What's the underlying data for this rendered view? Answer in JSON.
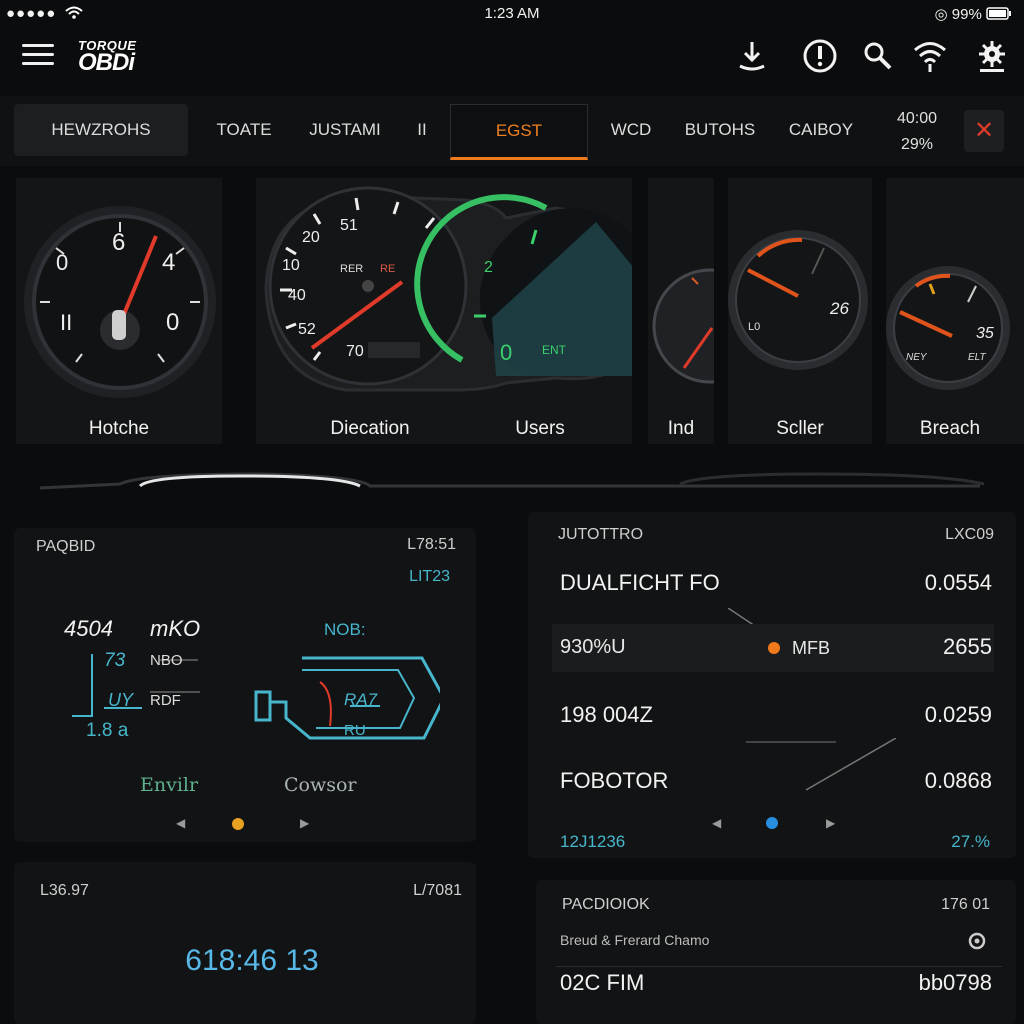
{
  "status_bar": {
    "signal": "●●●●●",
    "time": "1:23 AM",
    "battery": "99%"
  },
  "app": {
    "logo_line1": "TORQUE",
    "logo_line2": "OBDi"
  },
  "icons": [
    "menu-icon",
    "download-icon",
    "alert-icon",
    "search-icon",
    "wifi-icon",
    "settings-icon"
  ],
  "tabs": {
    "items": [
      "HEWZROHS",
      "TOATE",
      "JUSTAMI",
      "II",
      "EGST",
      "WCD",
      "BUTOHS",
      "CAIBOY"
    ],
    "active_index": 4,
    "stat_top": "40:00",
    "stat_bottom": "29%",
    "close": "✕"
  },
  "gauges": {
    "labels": [
      "Hotche",
      "Diecation",
      "Users",
      "Ind",
      "Scller",
      "Breach"
    ],
    "g1_ticks": [
      "6",
      "4",
      "0",
      "0",
      "II"
    ],
    "speedo_ticks": [
      "10",
      "20",
      "40",
      "52",
      "51",
      "70"
    ],
    "speedo_sub": [
      "RER",
      "RE"
    ],
    "green_ticks": [
      "2",
      "0",
      "ENT"
    ],
    "g5_ticks": [
      "26",
      "L0"
    ],
    "g6_ticks": [
      "35",
      "NEY",
      "ELT"
    ]
  },
  "card_left_top": {
    "title": "PAQBID",
    "code": "L78:51",
    "sub": "LIT23",
    "big_value": "4504",
    "big_unit": "mKO",
    "ticks": [
      "73",
      "NBO",
      "UY",
      "RDF",
      "1.8 a"
    ],
    "engine_label": "NOB:",
    "engine_labels": [
      "RA7",
      "RU"
    ],
    "footer_left": "Envilr",
    "footer_right": "Cowsor",
    "accent": "#e8a020"
  },
  "card_right_top": {
    "title": "JUTOTTRO",
    "code": "LXC09",
    "rows": [
      {
        "label": "DUALFICHT FO",
        "value": "0.0554"
      },
      {
        "label": "930%U",
        "mid": "MFB",
        "value": "2655"
      },
      {
        "label": "198 004Z",
        "value": "0.0259"
      },
      {
        "label": "FOBOTOR",
        "value": "0.0868"
      }
    ],
    "footer_left": "12J1236",
    "footer_right": "27.%",
    "accent": "#2a8ee0",
    "mid_dot_color": "#ef7a1c"
  },
  "card_left_bottom": {
    "title": "L36.97",
    "code": "L/7081",
    "value": "618:46 13"
  },
  "card_right_bottom": {
    "title": "PACDIOIOK",
    "code": "176 01",
    "subtitle": "Breud & Frerard Chamo",
    "row_label": "02C FIM",
    "row_value": "bb0798"
  }
}
